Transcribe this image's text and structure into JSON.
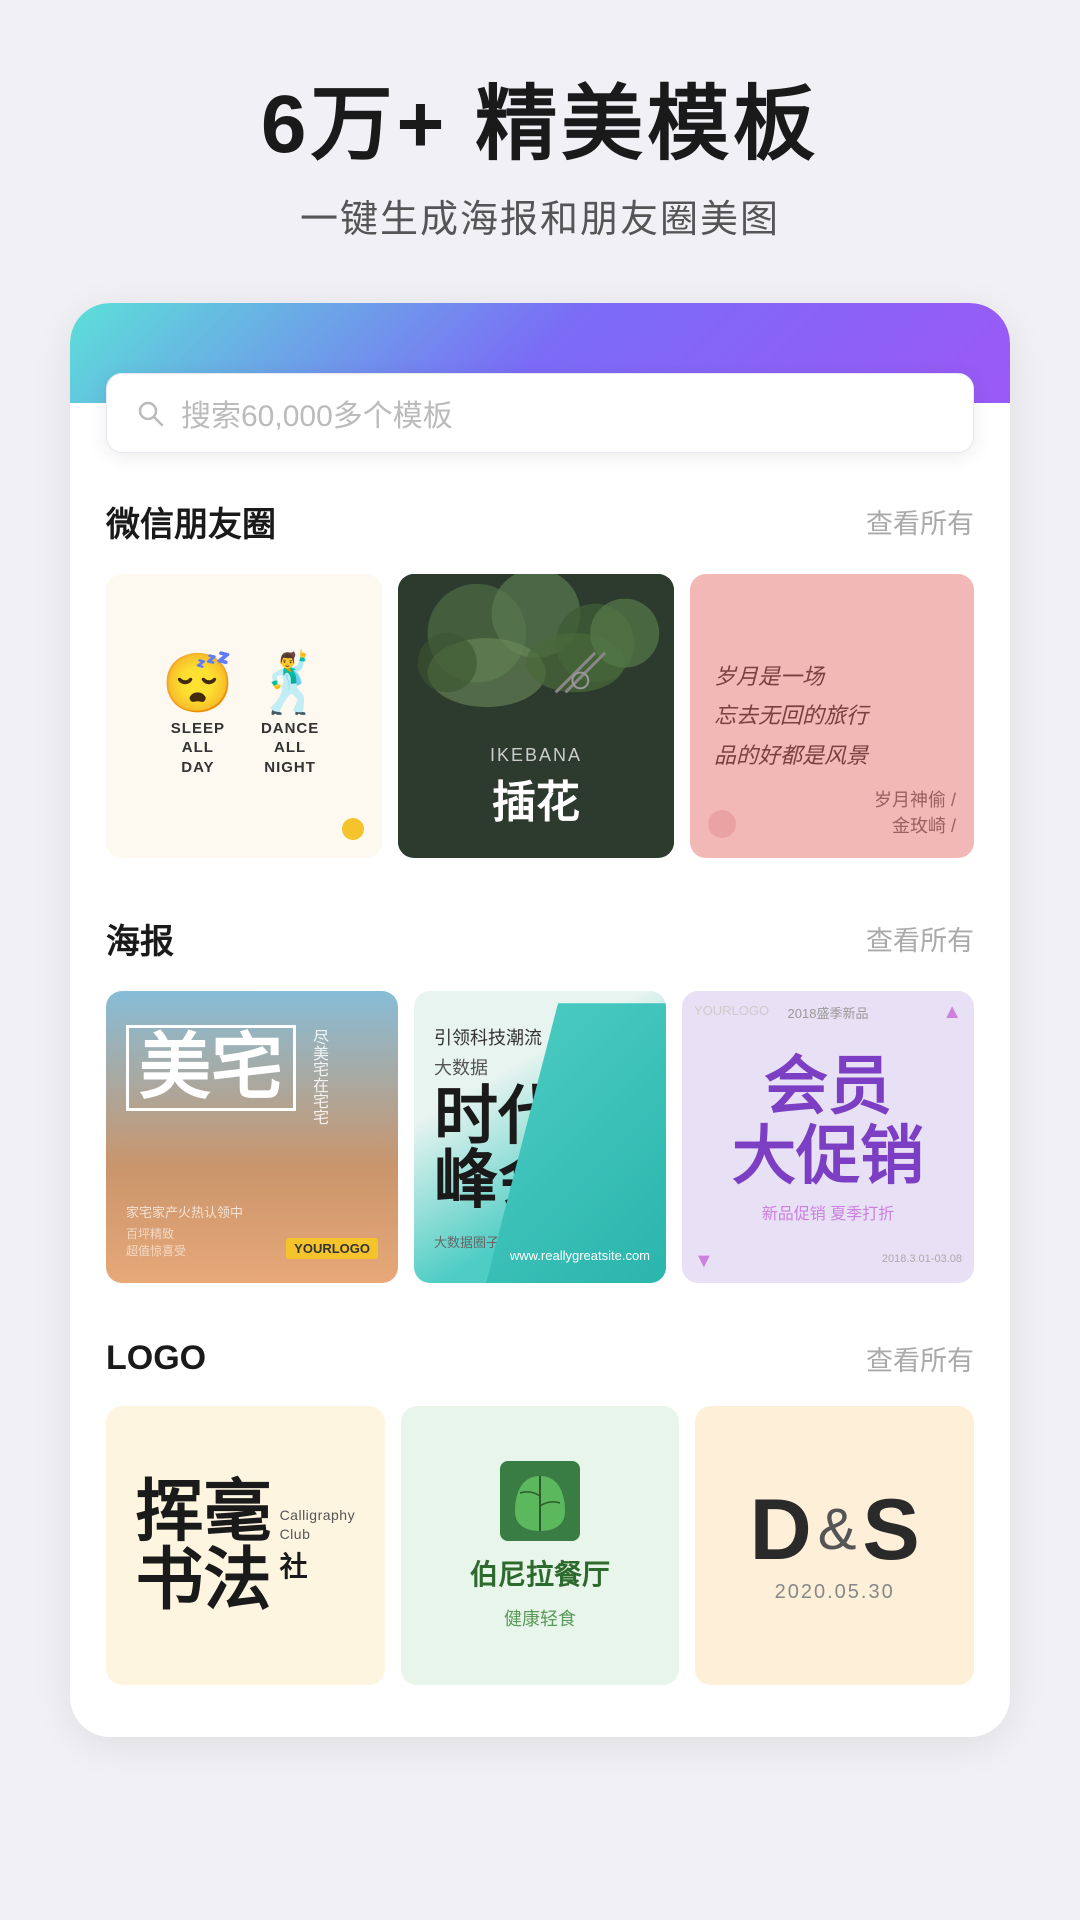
{
  "hero": {
    "title": "6万+ 精美模板",
    "subtitle": "一键生成海报和朋友圈美图"
  },
  "search": {
    "placeholder": "搜索60,000多个模板"
  },
  "sections": {
    "wechat": {
      "title": "微信朋友圈",
      "link": "查看所有",
      "templates": [
        {
          "type": "sleep-dance",
          "label1": "SLEEP ALL DAY",
          "label2": "DANCE ALL NIGHT"
        },
        {
          "type": "ikebana",
          "label_en": "IKEBANA",
          "label_cn": "插花"
        },
        {
          "type": "poem",
          "line1": "岁月是一场",
          "line2": "忘去无回的旅行",
          "line3": "品的好都是风景",
          "author1": "岁月神偷 /",
          "author2": "金玫崎 /"
        }
      ]
    },
    "poster": {
      "title": "海报",
      "link": "查看所有",
      "templates": [
        {
          "type": "meizhai",
          "main": "美宅",
          "side": "尽美宅在宅宅"
        },
        {
          "type": "bigdata",
          "line1": "时代",
          "line2": "峰会",
          "prefix": "大数据",
          "sub": "引领科技潮流"
        },
        {
          "type": "member",
          "main": "会员",
          "sub": "大促销",
          "year": "2018盛季新品",
          "badge": "YOURLOGO"
        }
      ]
    },
    "logo": {
      "title": "LOGO",
      "link": "查看所有",
      "templates": [
        {
          "type": "calligraphy",
          "cn": "挥毫书法",
          "en1": "Calligraphy",
          "en2": "Club",
          "cn2": "社"
        },
        {
          "type": "restaurant",
          "name": "伯尼拉餐厅",
          "sub": "健康轻食"
        },
        {
          "type": "ds",
          "letters": "D",
          "amp": "&",
          "letters2": "S",
          "date": "2020.05.30"
        }
      ]
    }
  }
}
